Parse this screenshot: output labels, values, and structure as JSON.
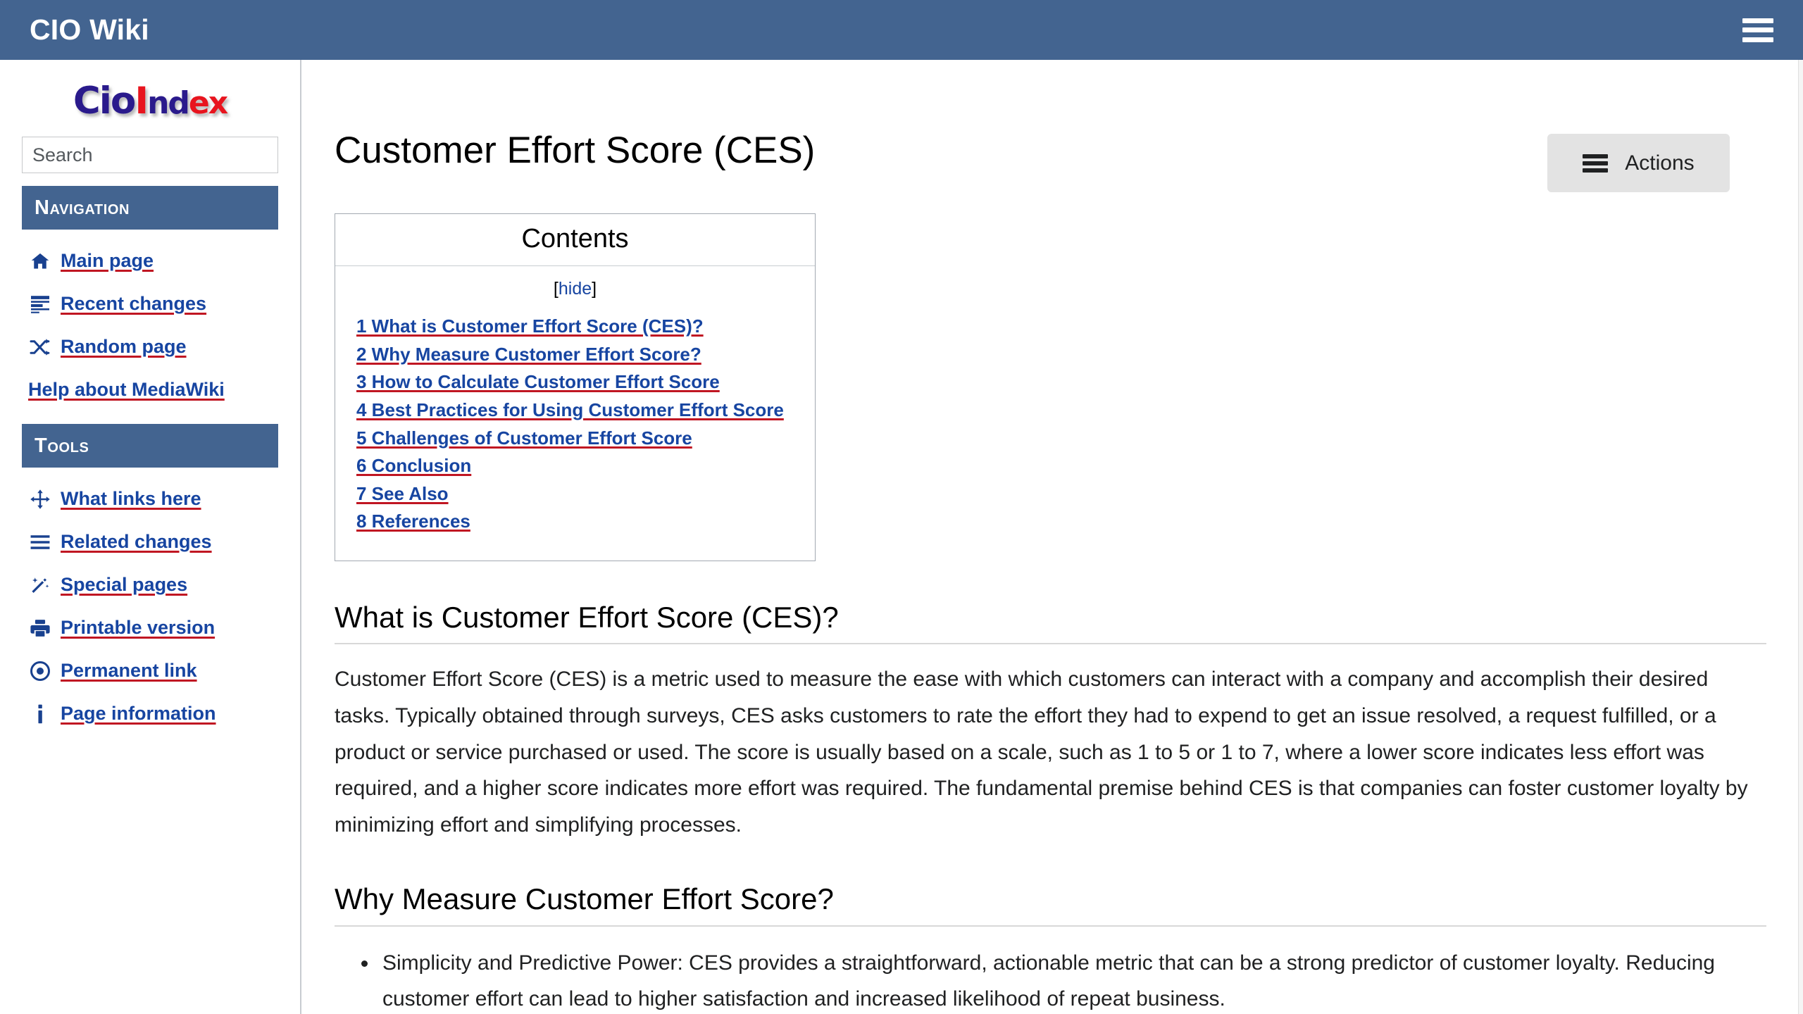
{
  "topbar": {
    "title": "CIO Wiki",
    "menu_icon": "hamburger-menu-icon"
  },
  "sidebar": {
    "logo": {
      "part1": "Cio",
      "part2": "I",
      "part3": "nd",
      "part4": "ex"
    },
    "search": {
      "value": "",
      "placeholder": "Search"
    },
    "portlets": [
      {
        "heading": "Navigation",
        "items": [
          {
            "label": "Main page",
            "icon": "home-icon"
          },
          {
            "label": "Recent changes",
            "icon": "recent-changes-icon"
          },
          {
            "label": "Random page",
            "icon": "shuffle-icon"
          },
          {
            "label": "Help about MediaWiki",
            "icon": ""
          }
        ]
      },
      {
        "heading": "Tools",
        "items": [
          {
            "label": "What links here",
            "icon": "arrows-move-icon"
          },
          {
            "label": "Related changes",
            "icon": "bars-icon"
          },
          {
            "label": "Special pages",
            "icon": "magic-wand-icon"
          },
          {
            "label": "Printable version",
            "icon": "printer-icon"
          },
          {
            "label": "Permanent link",
            "icon": "bullseye-icon"
          },
          {
            "label": "Page information",
            "icon": "info-icon"
          }
        ]
      }
    ]
  },
  "main": {
    "page_title": "Customer Effort Score (CES)",
    "actions_button": {
      "label": "Actions",
      "icon": "hamburger-menu-icon"
    },
    "toc": {
      "title": "Contents",
      "toggle_open": "[",
      "toggle_label": "hide",
      "toggle_close": "]",
      "entries": [
        "1 What is Customer Effort Score (CES)?",
        "2 Why Measure Customer Effort Score?",
        "3 How to Calculate Customer Effort Score",
        "4 Best Practices for Using Customer Effort Score",
        "5 Challenges of Customer Effort Score",
        "6 Conclusion",
        "7 See Also",
        "8 References"
      ]
    },
    "sections": [
      {
        "heading": "What is Customer Effort Score (CES)?",
        "paragraph": "Customer Effort Score (CES) is a metric used to measure the ease with which customers can interact with a company and accomplish their desired tasks. Typically obtained through surveys, CES asks customers to rate the effort they had to expend to get an issue resolved, a request fulfilled, or a product or service purchased or used. The score is usually based on a scale, such as 1 to 5 or 1 to 7, where a lower score indicates less effort was required, and a higher score indicates more effort was required. The fundamental premise behind CES is that companies can foster customer loyalty by minimizing effort and simplifying processes."
      },
      {
        "heading": "Why Measure Customer Effort Score?",
        "bullets": [
          "Simplicity and Predictive Power: CES provides a straightforward, actionable metric that can be a strong predictor of customer loyalty. Reducing customer effort can lead to higher satisfaction and increased likelihood of repeat business."
        ]
      }
    ]
  },
  "colors": {
    "header_blue": "#436490",
    "link_blue": "#1745a1",
    "link_underline_red": "#c01622",
    "button_gray": "#e3e3e3"
  }
}
